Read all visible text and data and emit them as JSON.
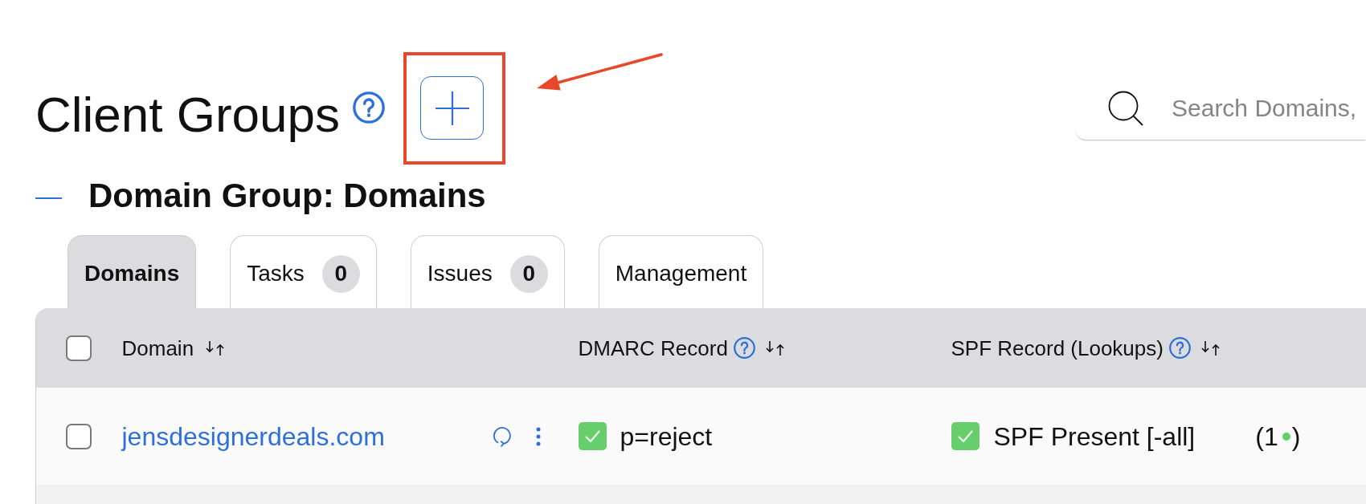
{
  "page": {
    "title": "Client Groups"
  },
  "search": {
    "placeholder": "Search Domains,"
  },
  "group": {
    "title": "Domain Group: Domains",
    "expanded": true
  },
  "tabs": [
    {
      "label": "Domains",
      "selected": true
    },
    {
      "label": "Tasks",
      "count": "0",
      "selected": false
    },
    {
      "label": "Issues",
      "count": "0",
      "selected": false
    },
    {
      "label": "Management",
      "selected": false
    }
  ],
  "table": {
    "select_all": {
      "checked": false
    },
    "columns": [
      {
        "label": "Domain",
        "help": false
      },
      {
        "label": "DMARC Record",
        "help": true
      },
      {
        "label": "SPF Record (Lookups)",
        "help": true
      }
    ],
    "rows": [
      {
        "checked": false,
        "domain": "jensdesignerdeals.com",
        "dmarc": {
          "valid": true,
          "value": "p=reject"
        },
        "spf": {
          "valid": true,
          "value": "SPF Present [-all]"
        },
        "lookups": {
          "count": "(1",
          "color": "#5fcf66",
          "close": ")"
        }
      }
    ]
  }
}
